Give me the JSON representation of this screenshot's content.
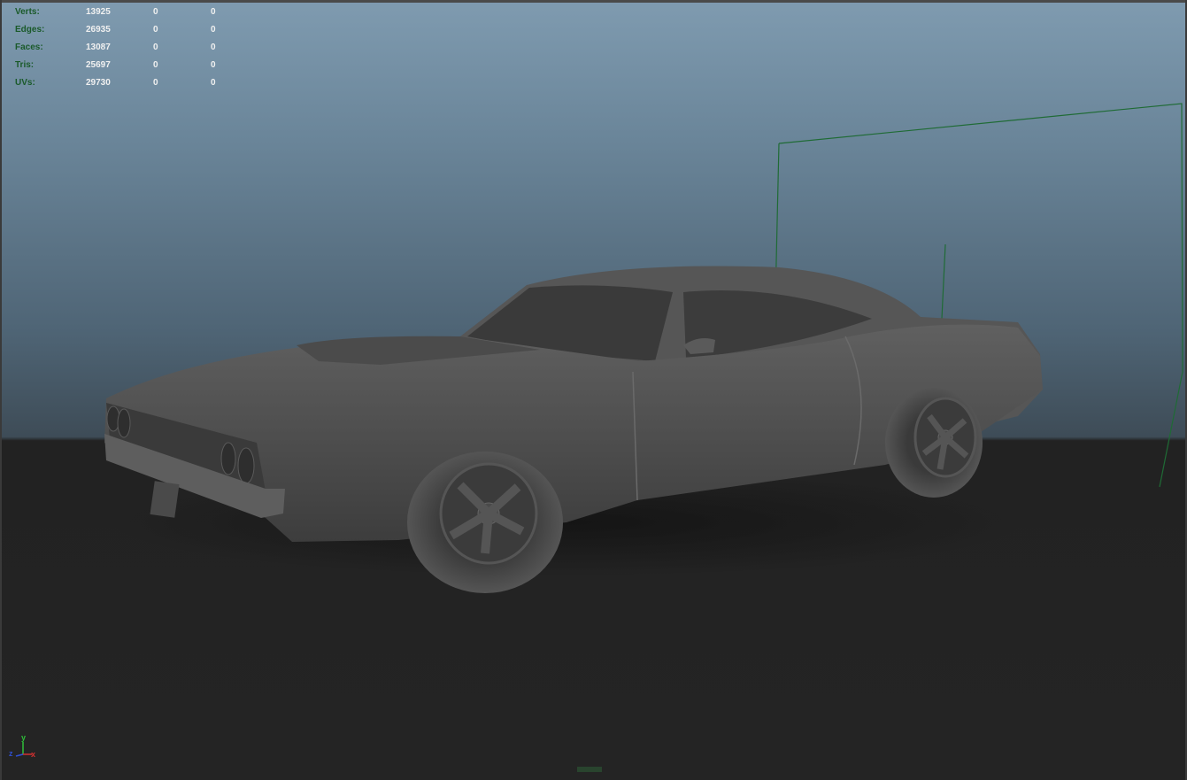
{
  "hud": {
    "rows": [
      {
        "label": "Verts:",
        "total": "13925",
        "selected": "0",
        "object": "0"
      },
      {
        "label": "Edges:",
        "total": "26935",
        "selected": "0",
        "object": "0"
      },
      {
        "label": "Faces:",
        "total": "13087",
        "selected": "0",
        "object": "0"
      },
      {
        "label": "Tris:",
        "total": "25697",
        "selected": "0",
        "object": "0"
      },
      {
        "label": "UVs:",
        "total": "29730",
        "selected": "0",
        "object": "0"
      }
    ]
  },
  "axis": {
    "y": "y",
    "z": "z",
    "x": "x"
  },
  "colors": {
    "hud_label": "#1a5a2a",
    "hud_value": "#f0f0f0",
    "camera_frame": "#1f6b35",
    "floor": "#222222",
    "model": "#555555"
  },
  "icons": {
    "axis_gizmo": "axis-gizmo-icon",
    "camera_frustum": "camera-frame-icon"
  }
}
